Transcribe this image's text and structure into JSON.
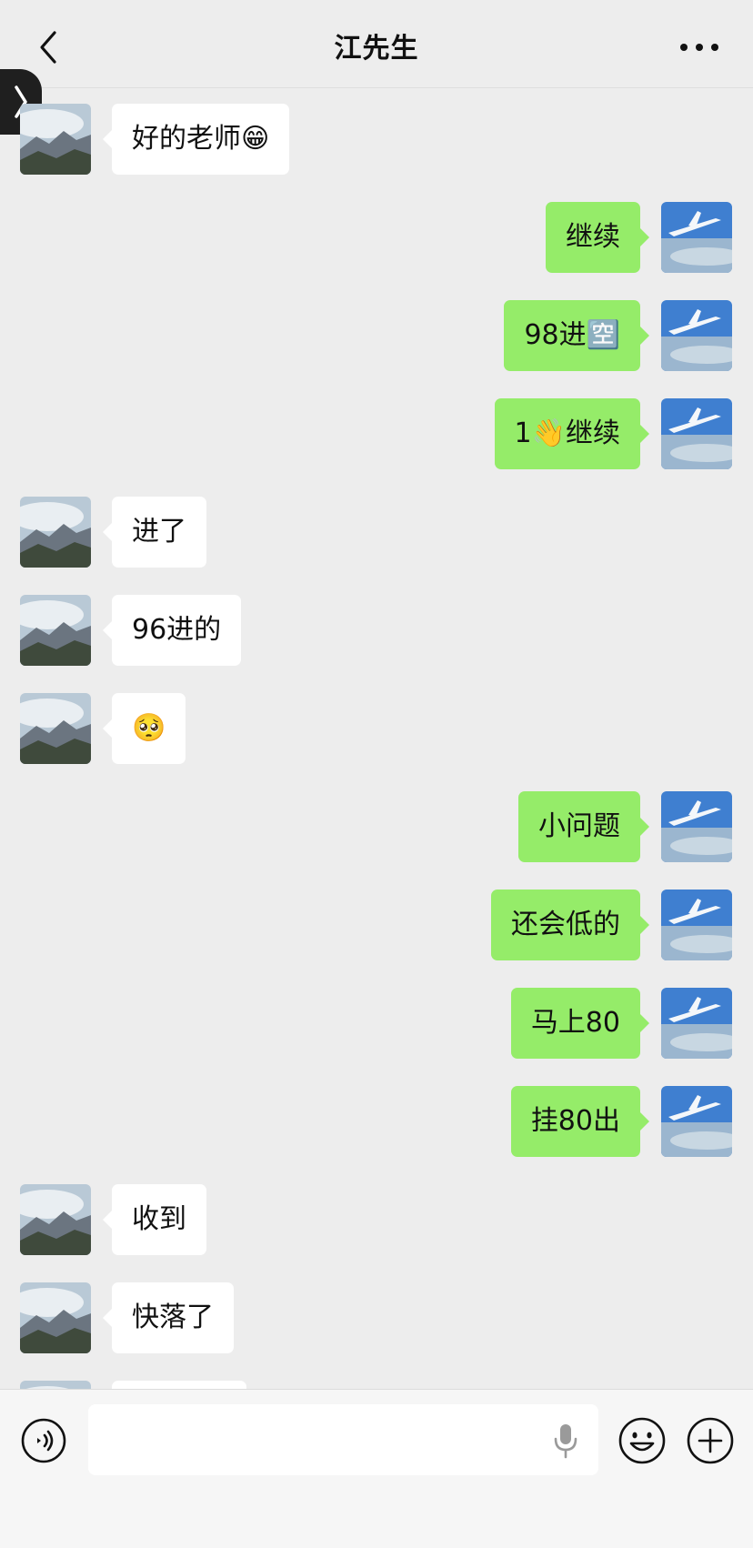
{
  "header": {
    "title": "江先生"
  },
  "messages": [
    {
      "side": "left",
      "text": "好的老师😁"
    },
    {
      "side": "right",
      "text": "继续"
    },
    {
      "side": "right",
      "text": "98进🈳"
    },
    {
      "side": "right",
      "text": "1👋继续"
    },
    {
      "side": "left",
      "text": "进了"
    },
    {
      "side": "left",
      "text": "96进的"
    },
    {
      "side": "left",
      "text": "🥺"
    },
    {
      "side": "right",
      "text": "小问题"
    },
    {
      "side": "right",
      "text": "还会低的"
    },
    {
      "side": "right",
      "text": "马上80"
    },
    {
      "side": "right",
      "text": "挂80出"
    },
    {
      "side": "left",
      "text": "收到"
    },
    {
      "side": "left",
      "text": "快落了"
    },
    {
      "side": "left",
      "text": ""
    }
  ],
  "input": {
    "value": "",
    "placeholder": ""
  },
  "icons": {
    "back": "chevron-left-icon",
    "more": "more-dots-icon",
    "side_tab": "chevron-right-icon",
    "voice": "voice-icon",
    "mic": "microphone-icon",
    "emoji": "emoji-icon",
    "plus": "plus-icon"
  },
  "colors": {
    "background": "#ededed",
    "incoming_bubble": "#ffffff",
    "outgoing_bubble": "#95ec69",
    "input_bar": "#f6f6f6"
  }
}
